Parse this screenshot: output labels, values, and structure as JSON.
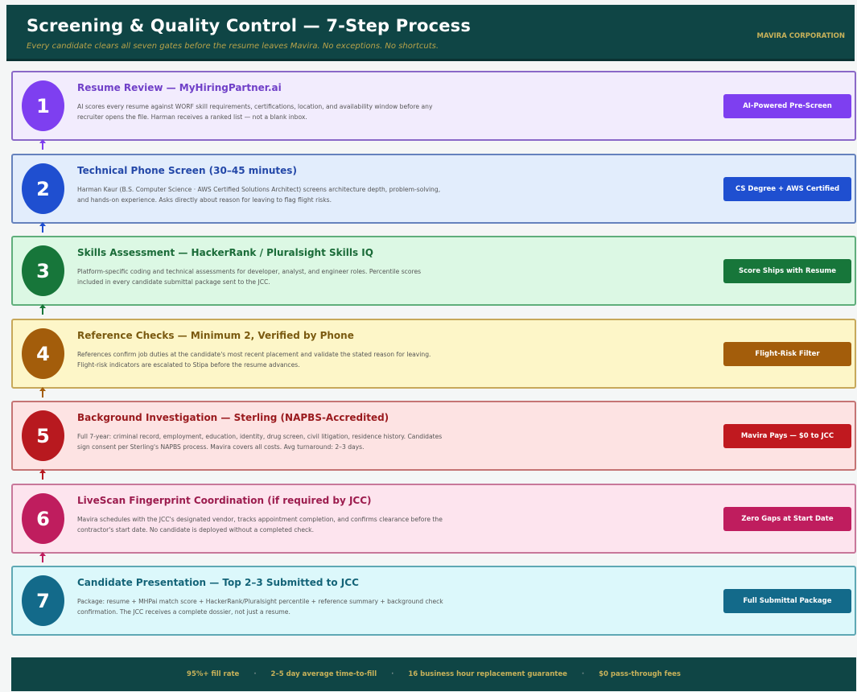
{
  "header": {
    "title": "Screening & Quality Control  —  7-Step Process",
    "subtitle": "Every candidate clears all seven gates before the resume leaves Mavira.  No exceptions.  No shortcuts.",
    "corp": "MAVIRA CORPORATION"
  },
  "steps": [
    {
      "number": "1",
      "title": "Resume Review  —  MyHiringPartner.ai",
      "desc": "AI scores every resume against WORF skill requirements, certifications, location, and availability window before any recruiter opens the file. Harman receives a ranked list — not a blank inbox.",
      "badge": "AI-Powered Pre-Screen",
      "colors": {
        "bg": "#f2ecfd",
        "border": "#8a68c8",
        "circle": "#7e3ff0",
        "title": "#7040c8",
        "badge": "#7e3ff0"
      }
    },
    {
      "number": "2",
      "title": "Technical Phone Screen  (30–45 minutes)",
      "desc": "Harman Kaur (B.S. Computer Science · AWS Certified Solutions Architect) screens architecture depth, problem-solving, and hands-on experience. Asks directly about reason for leaving to flag flight risks.",
      "badge": "CS Degree + AWS Certified",
      "colors": {
        "bg": "#e2edfc",
        "border": "#6582bd",
        "circle": "#1f4fd0",
        "title": "#2448a8",
        "badge": "#1f4fd0"
      }
    },
    {
      "number": "3",
      "title": "Skills Assessment  —  HackerRank / Pluralsight Skills IQ",
      "desc": "Platform-specific coding and technical assessments for developer, analyst, and engineer roles. Percentile scores included in every candidate submittal package sent to the JCC.",
      "badge": "Score Ships with Resume",
      "colors": {
        "bg": "#dcf8e4",
        "border": "#5fae7b",
        "circle": "#17763a",
        "title": "#1a6b38",
        "badge": "#17763a"
      }
    },
    {
      "number": "4",
      "title": "Reference Checks  —  Minimum 2, Verified by Phone",
      "desc": "References confirm job duties at the candidate's most recent placement and validate the stated reason for leaving. Flight-risk indicators are escalated to Stipa before the resume advances.",
      "badge": "Flight-Risk Filter",
      "colors": {
        "bg": "#fdf6c8",
        "border": "#c7a85a",
        "circle": "#a35d0b",
        "title": "#7a5a10",
        "badge": "#a35d0b"
      }
    },
    {
      "number": "5",
      "title": "Background Investigation  —  Sterling (NAPBS-Accredited)",
      "desc": "Full 7-year: criminal record, employment, education, identity, drug screen, civil litigation, residence history. Candidates sign consent per Sterling's NAPBS process. Mavira covers all costs. Avg turnaround: 2–3 days.",
      "badge": "Mavira Pays — $0 to JCC",
      "colors": {
        "bg": "#fde3e3",
        "border": "#c57474",
        "circle": "#b8191f",
        "title": "#9a1a1e",
        "badge": "#c0191f"
      }
    },
    {
      "number": "6",
      "title": "LiveScan Fingerprint Coordination  (if required by JCC)",
      "desc": "Mavira schedules with the JCC's designated vendor, tracks appointment completion, and confirms clearance before the contractor's start date. No candidate is deployed without a completed check.",
      "badge": "Zero Gaps at Start Date",
      "colors": {
        "bg": "#fde4ee",
        "border": "#c8779a",
        "circle": "#bf1d5e",
        "title": "#9c1c4e",
        "badge": "#bf1d5e"
      }
    },
    {
      "number": "7",
      "title": "Candidate Presentation  —  Top 2–3 Submitted to JCC",
      "desc": "Package: resume + MHPai match score + HackerRank/Pluralsight percentile + reference summary + background check confirmation. The JCC receives a complete dossier, not just a resume.",
      "badge": "Full Submittal Package",
      "colors": {
        "bg": "#dcf8fb",
        "border": "#5ea8b4",
        "circle": "#136a8a",
        "title": "#146478",
        "badge": "#136a8a"
      }
    }
  ],
  "footer": {
    "stats": [
      "95%+ fill rate",
      "2–5 day average time-to-fill",
      "16 business hour replacement guarantee",
      "$0 pass-through fees"
    ],
    "separator": "·"
  }
}
